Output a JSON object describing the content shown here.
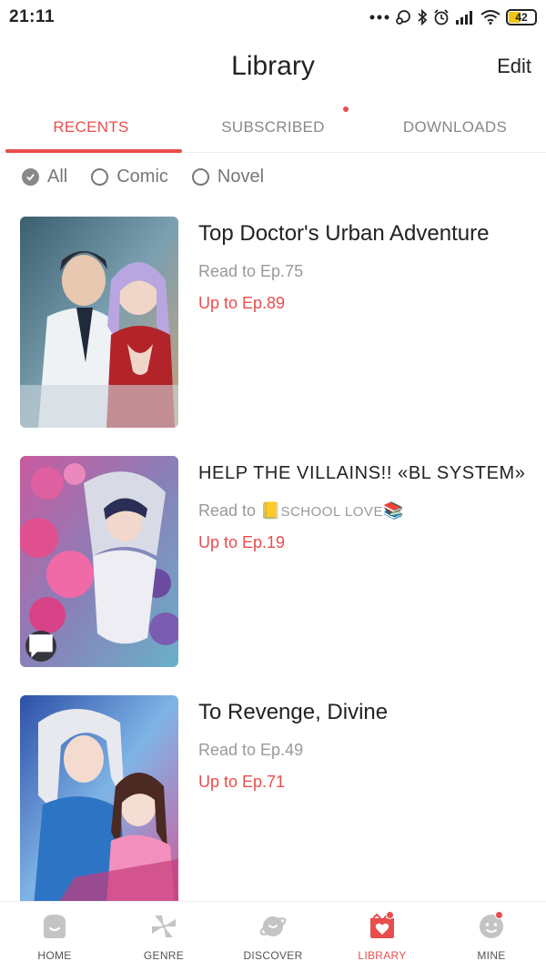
{
  "status_bar": {
    "time": "21:11",
    "icons": [
      "more-dots-icon",
      "sync-icon",
      "bluetooth-icon",
      "alarm-icon",
      "signal-icon",
      "wifi-icon"
    ],
    "battery": "42"
  },
  "header": {
    "title": "Library",
    "edit_label": "Edit"
  },
  "tabs": [
    {
      "label": "RECENTS",
      "active": true
    },
    {
      "label": "SUBSCRIBED",
      "active": false,
      "badge": true
    },
    {
      "label": "DOWNLOADS",
      "active": false
    }
  ],
  "filters": [
    {
      "label": "All",
      "checked": true
    },
    {
      "label": "Comic",
      "checked": false
    },
    {
      "label": "Novel",
      "checked": false
    }
  ],
  "items": [
    {
      "title": "Top Doctor's Urban Adventure",
      "read_to": "Read to Ep.75",
      "up_to": "Up to Ep.89"
    },
    {
      "title": "HELP THE VILLAINS!! «BL SYSTEM»",
      "read_prefix": "Read to ",
      "read_emoji_1": "📒",
      "read_value": "SCHOOL LOVE",
      "read_emoji_2": "📚",
      "up_to": "Up to Ep.19"
    },
    {
      "title": "To Revenge, Divine",
      "read_to": "Read to Ep.49",
      "up_to": "Up to Ep.71"
    }
  ],
  "bottom_nav": [
    {
      "label": "HOME",
      "icon": "home-icon"
    },
    {
      "label": "GENRE",
      "icon": "genre-icon"
    },
    {
      "label": "DISCOVER",
      "icon": "discover-icon"
    },
    {
      "label": "LIBRARY",
      "icon": "library-icon",
      "active": true,
      "badge": true
    },
    {
      "label": "MINE",
      "icon": "mine-icon",
      "badge": true
    }
  ],
  "colors": {
    "accent": "#e94d4d",
    "muted": "#999999",
    "text": "#222222"
  }
}
